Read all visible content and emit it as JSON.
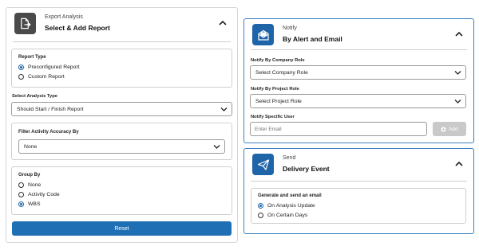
{
  "export": {
    "subtitle": "Export Analysis",
    "title": "Select & Add Report",
    "report_type": {
      "title": "Report Type",
      "options": [
        "Preconfigured Report",
        "Custom Report"
      ],
      "selected": "Preconfigured Report"
    },
    "analysis_type": {
      "label": "Select Analysis Type",
      "value": "Should Start / Finish Report"
    },
    "filter_accuracy": {
      "title": "Filter Activity Accuracy By",
      "value": "None"
    },
    "group_by": {
      "title": "Group By",
      "options": [
        "None",
        "Activity Code",
        "WBS"
      ],
      "selected": "WBS"
    },
    "reset_label": "Reset"
  },
  "notify": {
    "subtitle": "Notify",
    "title": "By Alert and Email",
    "company_role": {
      "label": "Notify By Company Role",
      "value": "Select Company Role"
    },
    "project_role": {
      "label": "Notify By Project Role",
      "value": "Select Project Role"
    },
    "specific_user": {
      "label": "Notify Specific User",
      "placeholder": "Enter Email",
      "add_label": "Add"
    }
  },
  "send": {
    "subtitle": "Send",
    "title": "Delivery Event",
    "generate": {
      "title": "Generate and send an email",
      "options": [
        "On Analysis Update",
        "On Certain Days"
      ],
      "selected": "On Analysis Update"
    }
  },
  "colors": {
    "accent": "#1f6fb4",
    "panel_border_active": "#3b7fc4",
    "disabled_button": "#c9c9c9",
    "icon_dark": "#4a4a4a"
  },
  "icons": [
    "export-file-icon",
    "mail-open-icon",
    "paper-plane-icon",
    "chevron-up-icon",
    "chevron-down-icon",
    "plus-circle-icon"
  ]
}
